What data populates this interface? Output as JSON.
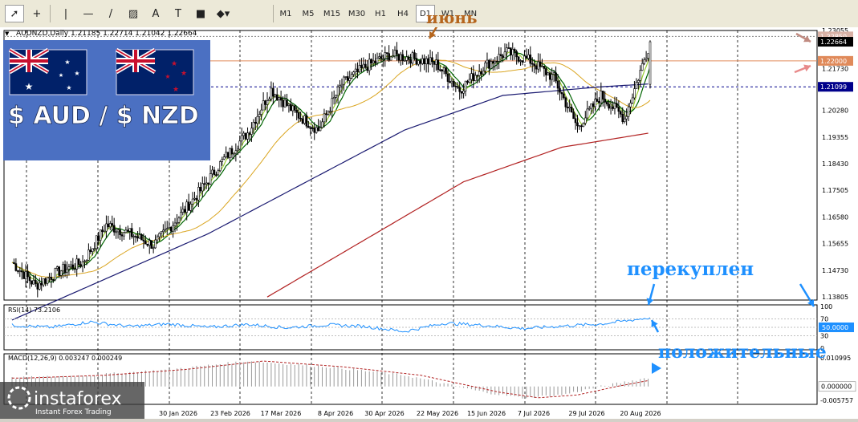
{
  "toolbar": {
    "tools": [
      {
        "name": "cursor-tool-icon",
        "glyph": "➚"
      },
      {
        "name": "crosshair-tool-icon",
        "glyph": "+"
      },
      {
        "name": "vertical-line-tool-icon",
        "glyph": "|"
      },
      {
        "name": "horizontal-line-tool-icon",
        "glyph": "—"
      },
      {
        "name": "trendline-tool-icon",
        "glyph": "/"
      },
      {
        "name": "channel-tool-icon",
        "glyph": "▨"
      },
      {
        "name": "text-tool-icon",
        "glyph": "A"
      },
      {
        "name": "label-tool-icon",
        "glyph": "T"
      },
      {
        "name": "rectangle-tool-icon",
        "glyph": "■"
      },
      {
        "name": "shapes-tool-icon",
        "glyph": "◆▾"
      }
    ],
    "timeframes": [
      "M1",
      "M5",
      "M15",
      "M30",
      "H1",
      "H4",
      "D1",
      "W1",
      "MN"
    ],
    "active_timeframe": "D1"
  },
  "chart_header": "AUDNZD,Daily  1.21185 1.22714 1.21042 1.22664",
  "banner": {
    "label": "$ AUD / $ NZD"
  },
  "watermark": {
    "brand": "instaforex",
    "tagline": "Instant Forex Trading"
  },
  "annotations": {
    "top": "июнь",
    "overbought": "перекуплен",
    "positive": "положительные"
  },
  "price_labels": {
    "last_price": "1.22664",
    "level_top": "1.22850",
    "level_mid": "1.22000",
    "level_low": "1.21099"
  },
  "colors": {
    "candle": "#000000",
    "ma_fast_light": "#9acd32",
    "ma_fast_dark": "#006400",
    "ma_mid": "#daa520",
    "ma_slow": "#191970",
    "ma_long": "#b22222",
    "level_line": "#e08a5a",
    "dash_line": "#00008b",
    "annotation_blue": "#1e90ff",
    "annotation_brown": "#b5651d",
    "rsi_line": "#1e90ff",
    "macd_signal": "#b22222"
  },
  "chart_data": [
    {
      "type": "candlestick",
      "title": "AUDNZD,Daily",
      "last": {
        "open": 1.21185,
        "high": 1.22714,
        "low": 1.21042,
        "close": 1.22664
      },
      "ylim": [
        1.13805,
        1.23055
      ],
      "y_ticks": [
        1.23055,
        1.22664,
        1.2173,
        1.21099,
        1.2028,
        1.19355,
        1.1843,
        1.17505,
        1.1658,
        1.15655,
        1.1473,
        1.13805
      ],
      "x_tick_labels": [
        "30 Jan 2026",
        "23 Feb 2026",
        "17 Mar 2026",
        "8 Apr 2026",
        "30 Apr 2026",
        "22 May 2026",
        "15 Jun 2026",
        "7 Jul 2026",
        "29 Jul 2026",
        "20 Aug 2026"
      ],
      "levels": [
        1.2285,
        1.22,
        1.21099
      ],
      "series": [
        {
          "data_type": "price",
          "x": [
            0,
            12,
            24,
            36,
            48,
            60,
            72,
            84,
            96,
            108,
            120,
            132,
            144,
            156,
            168,
            180,
            192,
            204,
            216,
            228,
            240,
            252,
            264,
            276,
            288,
            300,
            312,
            325
          ],
          "values": [
            1.15,
            1.142,
            1.147,
            1.15,
            1.163,
            1.16,
            1.156,
            1.165,
            1.175,
            1.186,
            1.195,
            1.21,
            1.202,
            1.196,
            1.212,
            1.218,
            1.222,
            1.221,
            1.219,
            1.21,
            1.218,
            1.223,
            1.22,
            1.214,
            1.197,
            1.208,
            1.2,
            1.2266
          ]
        },
        {
          "data_type": "ma_slow",
          "x": [
            0,
            50,
            100,
            150,
            200,
            250,
            300,
            325
          ],
          "values": [
            1.13,
            1.145,
            1.16,
            1.178,
            1.196,
            1.208,
            1.211,
            1.212
          ]
        },
        {
          "data_type": "ma_long",
          "x": [
            130,
            180,
            230,
            280,
            325
          ],
          "values": [
            1.138,
            1.158,
            1.178,
            1.19,
            1.195
          ]
        }
      ]
    },
    {
      "type": "line",
      "title": "RSI(14) 73.2106",
      "ylim": [
        0,
        100
      ],
      "y_ticks": [
        100,
        70,
        50,
        30,
        0
      ],
      "marker_label": "50.0000",
      "series": [
        {
          "x": [
            0,
            20,
            40,
            60,
            80,
            100,
            120,
            140,
            160,
            180,
            200,
            220,
            240,
            260,
            280,
            300,
            325
          ],
          "values": [
            55,
            50,
            63,
            52,
            58,
            50,
            57,
            49,
            56,
            52,
            40,
            60,
            55,
            47,
            53,
            58,
            73.2106
          ]
        }
      ]
    },
    {
      "type": "bar",
      "title": "MACD(12,26,9) 0.003247 0.000249",
      "ylim": [
        -0.005757,
        0.010995
      ],
      "y_ticks": [
        0.010995,
        0.0,
        -0.005757
      ],
      "marker_label": "0.000000",
      "series": [
        {
          "x": [
            0,
            40,
            80,
            120,
            160,
            200,
            220,
            240,
            260,
            280,
            300,
            325
          ],
          "values": [
            0.003,
            0.004,
            0.006,
            0.009,
            0.007,
            0.004,
            0.001,
            -0.002,
            -0.004,
            -0.003,
            0.0,
            0.003247
          ]
        }
      ]
    }
  ]
}
